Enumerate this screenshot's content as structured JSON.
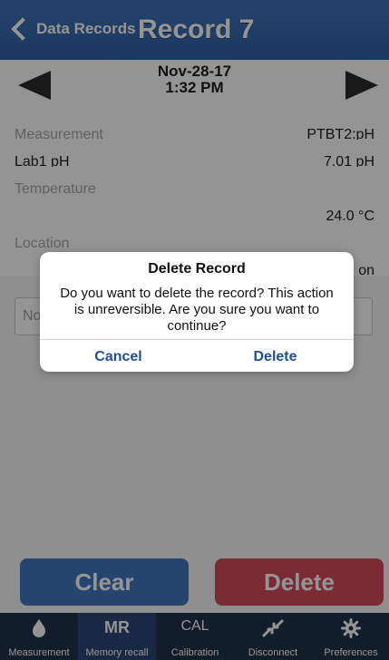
{
  "header": {
    "back_label": "Data Records",
    "title": "Record 7"
  },
  "record": {
    "date": "Nov-28-17",
    "time": "1:32 PM",
    "measurement_label": "Measurement",
    "measurement_value": "PTBT2:pH",
    "lab_label": "Lab1 pH",
    "lab_value": "7.01 pH",
    "temperature_label": "Temperature",
    "temperature_value": "24.0 °C",
    "location_label": "Location",
    "location_value": "on",
    "note_placeholder": "No"
  },
  "actions": {
    "clear_label": "Clear",
    "delete_label": "Delete"
  },
  "tabs": [
    {
      "label": "Measurement",
      "icon": "drop-icon"
    },
    {
      "label": "Memory recall",
      "icon": "MR"
    },
    {
      "label": "Calibration",
      "icon": "CAL"
    },
    {
      "label": "Disconnect",
      "icon": "disconnect-icon"
    },
    {
      "label": "Preferences",
      "icon": "gear-icon"
    }
  ],
  "dialog": {
    "title": "Delete Record",
    "message": "Do you want to delete the record? This action is unreversible. Are you sure you want to continue?",
    "cancel_label": "Cancel",
    "delete_label": "Delete"
  },
  "colors": {
    "header_blue": "#2f63a6",
    "clear_button": "#4178c0",
    "delete_button": "#d24b59",
    "tabbar": "#20324d",
    "dialog_button_text": "#1f4f9a"
  }
}
